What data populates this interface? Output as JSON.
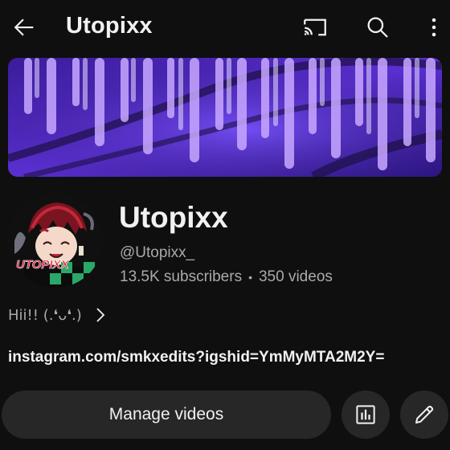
{
  "header": {
    "title": "Utopixx",
    "back_icon": "arrow-back-icon",
    "cast_icon": "cast-icon",
    "search_icon": "search-icon",
    "more_icon": "more-vertical-icon"
  },
  "banner": {
    "description": "purple-wisteria-banner"
  },
  "channel": {
    "name": "Utopixx",
    "handle": "@Utopixx_",
    "subscribers": "13.5K subscribers",
    "separator": "•",
    "videos": "350 videos",
    "avatar_text": "UTOPIXX"
  },
  "description": {
    "text": "Hii!! (.❛ᴗ❛.)",
    "link": "instagram.com/smkxedits?igshid=YmMyMTA2M2Y="
  },
  "actions": {
    "manage_label": "Manage videos",
    "analytics_icon": "analytics-icon",
    "edit_icon": "edit-pencil-icon"
  },
  "colors": {
    "background": "#0f0f0f",
    "button_bg": "#272727",
    "text_primary": "#f1f1f1",
    "text_secondary": "#aaaaaa",
    "banner_purple": "#5b2fd6"
  }
}
